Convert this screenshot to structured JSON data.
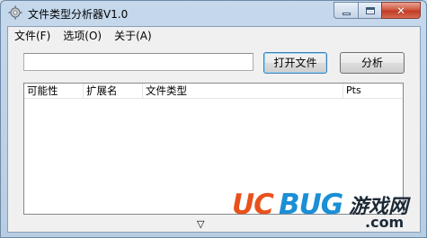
{
  "window": {
    "title": "文件类型分析器V1.0",
    "icon": "gear-icon",
    "caption": {
      "minimize": "minimize-icon",
      "maximize": "maximize-icon",
      "close": "✕"
    }
  },
  "menu": {
    "items": [
      "文件(F)",
      "选项(O)",
      "关于(A)"
    ]
  },
  "toolbar": {
    "path_value": "",
    "path_placeholder": "",
    "open_label": "打开文件",
    "analyze_label": "分析"
  },
  "list": {
    "columns": [
      "可能性",
      "扩展名",
      "文件类型",
      "Pts"
    ],
    "rows": []
  },
  "status": {
    "arrow": "▽"
  },
  "watermark": {
    "brand_a": "UC",
    "brand_b": "BUG",
    "cn": "游戏网",
    "domain": ".com",
    "colors": {
      "uc": "#e8511c",
      "bug": "#1b8fd6"
    }
  }
}
